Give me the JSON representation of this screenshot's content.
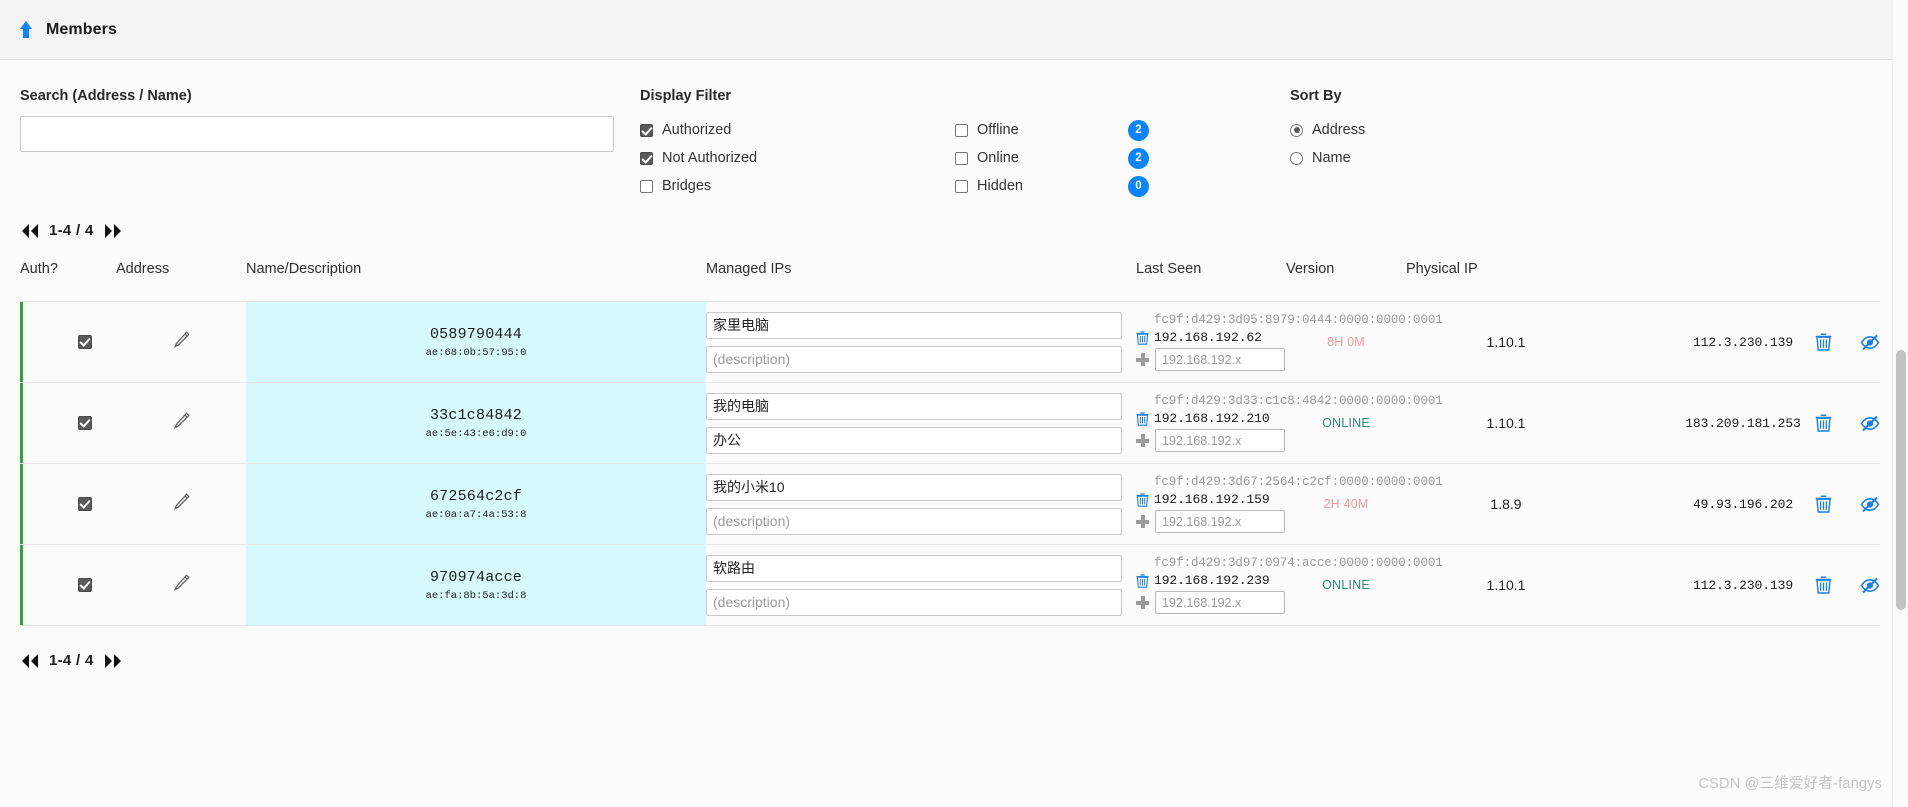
{
  "header": {
    "title": "Members",
    "icon": "arrow-up-icon"
  },
  "search": {
    "label": "Search (Address / Name)",
    "value": "",
    "placeholder": ""
  },
  "display_filter": {
    "label": "Display Filter",
    "left_items": [
      {
        "label": "Authorized",
        "checked": true
      },
      {
        "label": "Not Authorized",
        "checked": true
      },
      {
        "label": "Bridges",
        "checked": false
      }
    ],
    "right_items": [
      {
        "label": "Offline",
        "checked": false,
        "badge": "2"
      },
      {
        "label": "Online",
        "checked": false,
        "badge": "2"
      },
      {
        "label": "Hidden",
        "checked": false,
        "badge": "0"
      }
    ]
  },
  "sort_by": {
    "label": "Sort By",
    "options": [
      {
        "label": "Address",
        "selected": true
      },
      {
        "label": "Name",
        "selected": false
      }
    ]
  },
  "pagination": {
    "range_label": "1-4 / 4",
    "first_icon": "chevron-double-left-icon",
    "last_icon": "chevron-double-right-icon"
  },
  "table": {
    "columns": {
      "auth": "Auth?",
      "address": "Address",
      "name": "Name/Description",
      "managed_ips": "Managed IPs",
      "last_seen": "Last Seen",
      "version": "Version",
      "physical_ip": "Physical IP"
    },
    "ip_add_placeholder": "192.168.192.x",
    "description_placeholder": "(description)",
    "rows": [
      {
        "authorized": true,
        "address": "0589790444",
        "mac": "ae:68:0b:57:95:0",
        "name": "家里电脑",
        "description": "",
        "ipv6": "fc9f:d429:3d05:8979:0444:0000:0000:0001",
        "ipv4": "192.168.192.62",
        "ip_add_value": "",
        "last_seen": "8H 0M",
        "last_seen_state": "offline",
        "version": "1.10.1",
        "physical_ip": "112.3.230.139"
      },
      {
        "authorized": true,
        "address": "33c1c84842",
        "mac": "ae:5e:43:e6:d9:0",
        "name": "我的电脑",
        "description": "办公",
        "ipv6": "fc9f:d429:3d33:c1c8:4842:0000:0000:0001",
        "ipv4": "192.168.192.210",
        "ip_add_value": "",
        "last_seen": "ONLINE",
        "last_seen_state": "online",
        "version": "1.10.1",
        "physical_ip": "183.209.181.253"
      },
      {
        "authorized": true,
        "address": "672564c2cf",
        "mac": "ae:0a:a7:4a:53:8",
        "name": "我的小米10",
        "description": "",
        "ipv6": "fc9f:d429:3d67:2564:c2cf:0000:0000:0001",
        "ipv4": "192.168.192.159",
        "ip_add_value": "",
        "last_seen": "2H 40M",
        "last_seen_state": "offline",
        "version": "1.8.9",
        "physical_ip": "49.93.196.202"
      },
      {
        "authorized": true,
        "address": "970974acce",
        "mac": "ae:fa:8b:5a:3d:8",
        "name": "软路由",
        "description": "",
        "ipv6": "fc9f:d429:3d97:0974:acce:0000:0000:0001",
        "ipv4": "192.168.192.239",
        "ip_add_value": "",
        "last_seen": "ONLINE",
        "last_seen_state": "online",
        "version": "1.10.1",
        "physical_ip": "112.3.230.139"
      }
    ]
  },
  "icons": {
    "edit": "pencil-icon",
    "delete": "trash-icon",
    "hide": "eye-slash-icon",
    "add_ip": "plus-icon"
  },
  "colors": {
    "accent": "#0a84ff",
    "row_marker": "#2fa63a",
    "address_cell": "#d6fafb",
    "online": "#2f8a73",
    "offline": "#f09a9a"
  },
  "watermark": "CSDN @三维爱好者-fangys"
}
